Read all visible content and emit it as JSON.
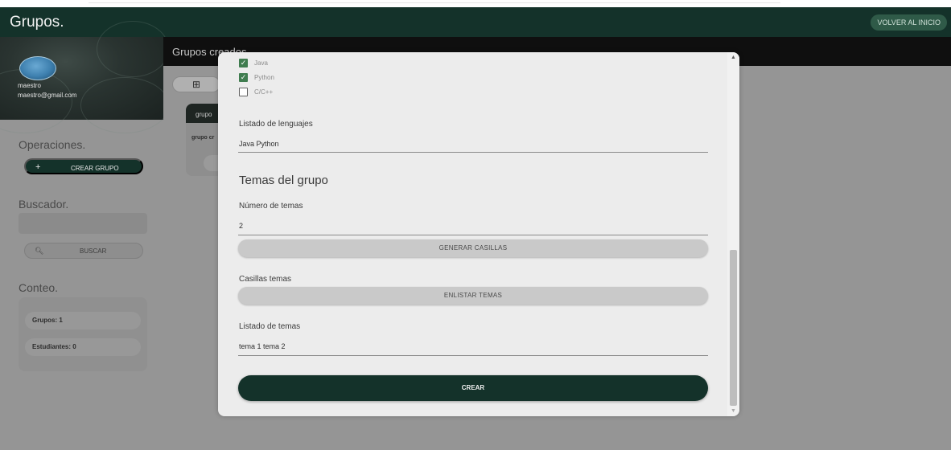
{
  "navbar": {
    "title": "Grupos.",
    "back_button": "VOLVER AL INICIO"
  },
  "profile": {
    "name": "maestro",
    "email": "maestro@gmail.com"
  },
  "sidebar": {
    "operations_title": "Operaciones.",
    "create_button": "CREAR GRUPO",
    "search_title": "Buscador.",
    "search_input_value": "",
    "search_button": "BUSCAR",
    "count_title": "Conteo.",
    "groups_count": "Grupos: 1",
    "students_count": "Estudiantes: 0"
  },
  "main": {
    "title": "Grupos creados",
    "card": {
      "header": "grupo",
      "body": "grupo cr"
    }
  },
  "modal": {
    "languages": [
      {
        "label": "Java",
        "checked": true
      },
      {
        "label": "Python",
        "checked": true
      },
      {
        "label": "C/C++",
        "checked": false
      }
    ],
    "languages_list_label": "Listado de lenguajes",
    "languages_list_value": "Java Python",
    "topics_section_title": "Temas del grupo",
    "topics_number_label": "Número de temas",
    "topics_number_value": "2",
    "generate_button": "GENERAR CASILLAS",
    "topics_boxes_label": "Casillas temas",
    "list_topics_button": "ENLISTAR TEMAS",
    "topics_list_label": "Listado de temas",
    "topics_list_value": "tema 1 tema 2",
    "create_button": "CREAR"
  },
  "colors": {
    "primary": "#14322a",
    "checkbox": "#3f7c4f",
    "overlay": "#959595"
  }
}
